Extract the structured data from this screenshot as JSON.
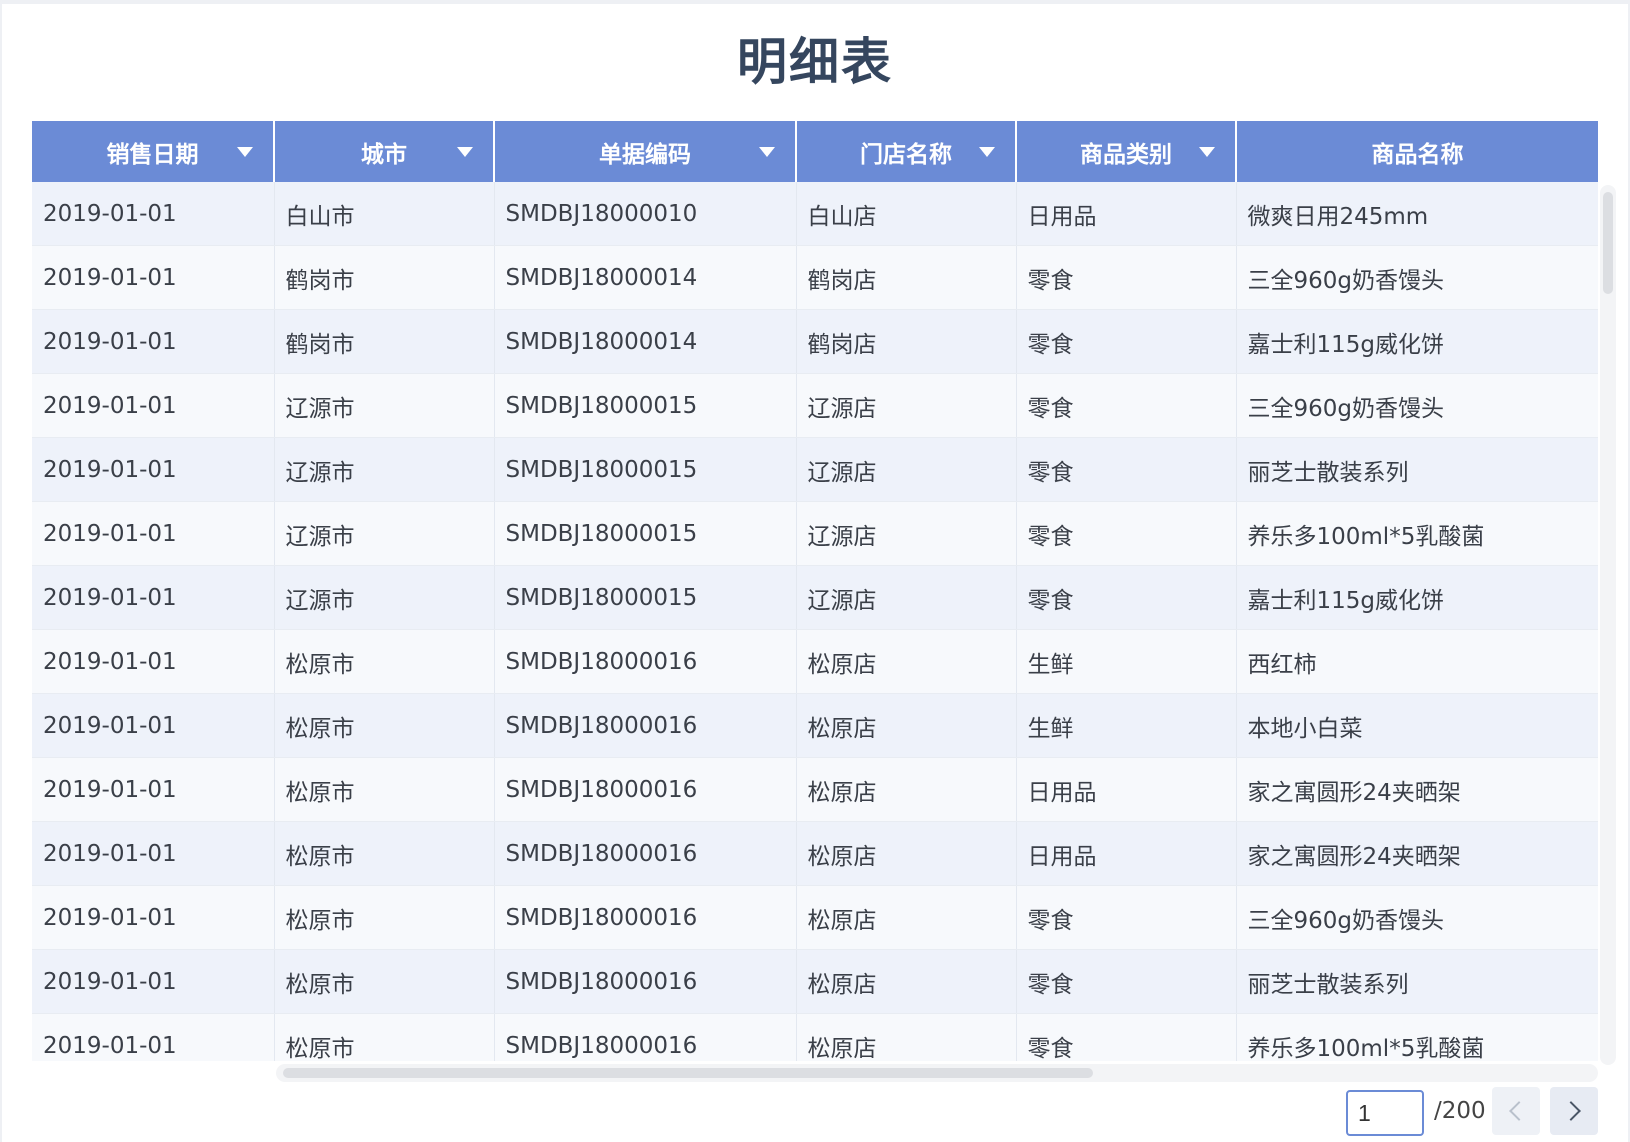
{
  "title": "明细表",
  "columns": [
    {
      "label": "销售日期",
      "filter": true
    },
    {
      "label": "城市",
      "filter": true
    },
    {
      "label": "单据编码",
      "filter": true
    },
    {
      "label": "门店名称",
      "filter": true
    },
    {
      "label": "商品类别",
      "filter": true
    },
    {
      "label": "商品名称",
      "filter": false
    }
  ],
  "rows": [
    [
      "2019-01-01",
      "白山市",
      "SMDBJ18000010",
      "白山店",
      "日用品",
      "微爽日用245mm"
    ],
    [
      "2019-01-01",
      "鹤岗市",
      "SMDBJ18000014",
      "鹤岗店",
      "零食",
      "三全960g奶香馒头"
    ],
    [
      "2019-01-01",
      "鹤岗市",
      "SMDBJ18000014",
      "鹤岗店",
      "零食",
      "嘉士利115g威化饼"
    ],
    [
      "2019-01-01",
      "辽源市",
      "SMDBJ18000015",
      "辽源店",
      "零食",
      "三全960g奶香馒头"
    ],
    [
      "2019-01-01",
      "辽源市",
      "SMDBJ18000015",
      "辽源店",
      "零食",
      "丽芝士散装系列"
    ],
    [
      "2019-01-01",
      "辽源市",
      "SMDBJ18000015",
      "辽源店",
      "零食",
      "养乐多100ml*5乳酸菌"
    ],
    [
      "2019-01-01",
      "辽源市",
      "SMDBJ18000015",
      "辽源店",
      "零食",
      "嘉士利115g威化饼"
    ],
    [
      "2019-01-01",
      "松原市",
      "SMDBJ18000016",
      "松原店",
      "生鲜",
      "西红柿"
    ],
    [
      "2019-01-01",
      "松原市",
      "SMDBJ18000016",
      "松原店",
      "生鲜",
      "本地小白菜"
    ],
    [
      "2019-01-01",
      "松原市",
      "SMDBJ18000016",
      "松原店",
      "日用品",
      "家之寓圆形24夹晒架"
    ],
    [
      "2019-01-01",
      "松原市",
      "SMDBJ18000016",
      "松原店",
      "日用品",
      "家之寓圆形24夹晒架"
    ],
    [
      "2019-01-01",
      "松原市",
      "SMDBJ18000016",
      "松原店",
      "零食",
      "三全960g奶香馒头"
    ],
    [
      "2019-01-01",
      "松原市",
      "SMDBJ18000016",
      "松原店",
      "零食",
      "丽芝士散装系列"
    ],
    [
      "2019-01-01",
      "松原市",
      "SMDBJ18000016",
      "松原店",
      "零食",
      "养乐多100ml*5乳酸菌"
    ]
  ],
  "pagination": {
    "current_page": "1",
    "total_label": "/200",
    "prev_icon": "chevron-left-icon",
    "next_icon": "chevron-right-icon"
  },
  "colors": {
    "header_bg": "#6b8bd6",
    "title": "#35465e",
    "row_odd": "#eef2fa",
    "row_even": "#f7f9fc"
  }
}
